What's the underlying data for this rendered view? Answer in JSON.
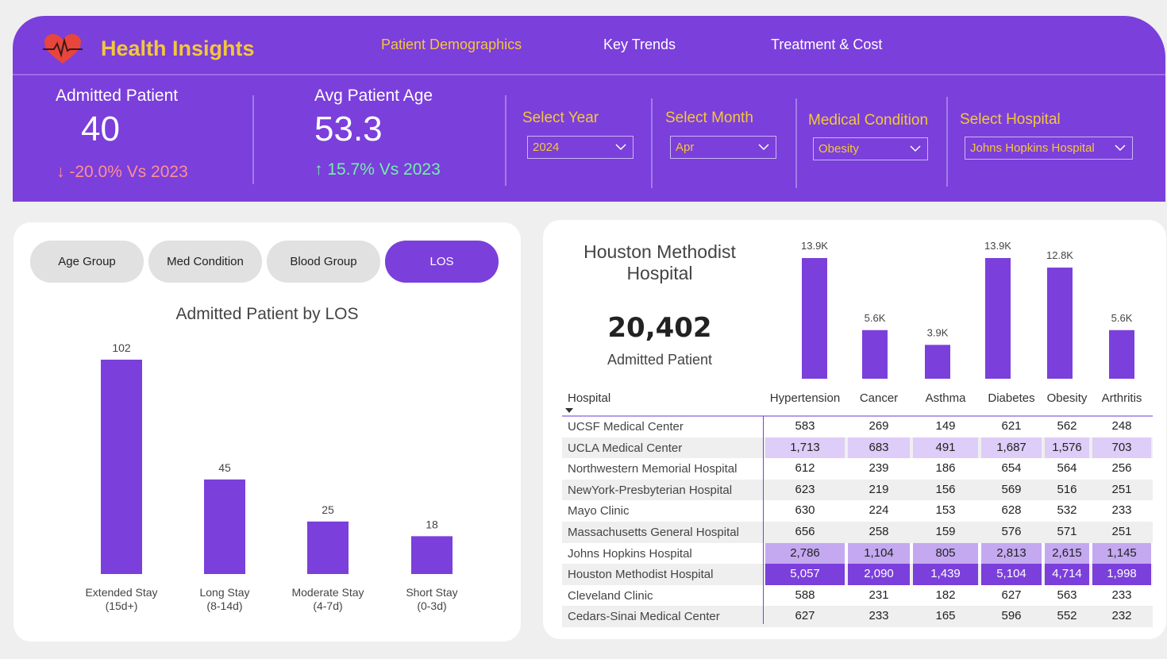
{
  "header": {
    "title": "Health Insights",
    "nav": [
      "Patient Demographics",
      "Key Trends",
      "Treatment & Cost"
    ],
    "active_nav": "Patient Demographics"
  },
  "kpis": {
    "admitted": {
      "label": "Admitted Patient",
      "value": "40",
      "delta": "↓ -20.0% Vs 2023"
    },
    "age": {
      "label": "Avg Patient Age",
      "value": "53.3",
      "delta": "↑ 15.7% Vs 2023"
    }
  },
  "filters": {
    "year": {
      "label": "Select Year",
      "value": "2024"
    },
    "month": {
      "label": "Select Month",
      "value": "Apr"
    },
    "condition": {
      "label": "Medical Condition",
      "value": "Obesity"
    },
    "hospital": {
      "label": "Select Hospital",
      "value": "Johns Hopkins Hospital"
    }
  },
  "tabs": [
    "Age Group",
    "Med Condition",
    "Blood Group",
    "LOS"
  ],
  "active_tab": "LOS",
  "colors": {
    "accent": "#7b3fdb",
    "gold": "#f3c73c",
    "down": "#ff8f8f",
    "up": "#72f0a8"
  },
  "chart_data": [
    {
      "type": "bar",
      "title": "Admitted Patient by LOS",
      "categories": [
        "Extended Stay (15d+)",
        "Long Stay (8-14d)",
        "Moderate Stay (4-7d)",
        "Short Stay (0-3d)"
      ],
      "category_lines": [
        [
          "Extended Stay",
          "(15d+)"
        ],
        [
          "Long Stay",
          "(8-14d)"
        ],
        [
          "Moderate Stay",
          "(4-7d)"
        ],
        [
          "Short Stay",
          "(0-3d)"
        ]
      ],
      "values": [
        102,
        45,
        25,
        18
      ],
      "labels": [
        "102",
        "45",
        "25",
        "18"
      ],
      "ylim": [
        0,
        102
      ]
    },
    {
      "type": "bar",
      "categories": [
        "Hypertension",
        "Cancer",
        "Asthma",
        "Diabetes",
        "Obesity",
        "Arthritis"
      ],
      "values": [
        13900,
        5600,
        3900,
        13900,
        12800,
        5600
      ],
      "labels": [
        "13.9K",
        "5.6K",
        "3.9K",
        "13.9K",
        "12.8K",
        "5.6K"
      ]
    }
  ],
  "hospital_summary": {
    "name": "Houston Methodist Hospital",
    "count": "20,402",
    "count_label": "Admitted Patient"
  },
  "matrix": {
    "row_header": "Hospital",
    "columns": [
      "Hypertension",
      "Cancer",
      "Asthma",
      "Diabetes",
      "Obesity",
      "Arthritis"
    ],
    "rows": [
      {
        "name": "UCSF Medical Center",
        "values": [
          "583",
          "269",
          "149",
          "621",
          "562",
          "248"
        ]
      },
      {
        "name": "UCLA Medical Center",
        "values": [
          "1,713",
          "683",
          "491",
          "1,687",
          "1,576",
          "703"
        ]
      },
      {
        "name": "Northwestern Memorial Hospital",
        "values": [
          "612",
          "239",
          "186",
          "654",
          "564",
          "256"
        ]
      },
      {
        "name": "NewYork-Presbyterian Hospital",
        "values": [
          "623",
          "219",
          "156",
          "569",
          "516",
          "251"
        ]
      },
      {
        "name": "Mayo Clinic",
        "values": [
          "630",
          "224",
          "153",
          "628",
          "532",
          "233"
        ]
      },
      {
        "name": "Massachusetts General Hospital",
        "values": [
          "656",
          "258",
          "159",
          "576",
          "571",
          "251"
        ]
      },
      {
        "name": "Johns Hopkins Hospital",
        "values": [
          "2,786",
          "1,104",
          "805",
          "2,813",
          "2,615",
          "1,145"
        ]
      },
      {
        "name": "Houston Methodist Hospital",
        "values": [
          "5,057",
          "2,090",
          "1,439",
          "5,104",
          "4,714",
          "1,998"
        ]
      },
      {
        "name": "Cleveland Clinic",
        "values": [
          "588",
          "231",
          "182",
          "627",
          "563",
          "233"
        ]
      },
      {
        "name": "Cedars-Sinai Medical Center",
        "values": [
          "627",
          "233",
          "165",
          "596",
          "552",
          "232"
        ]
      }
    ]
  }
}
